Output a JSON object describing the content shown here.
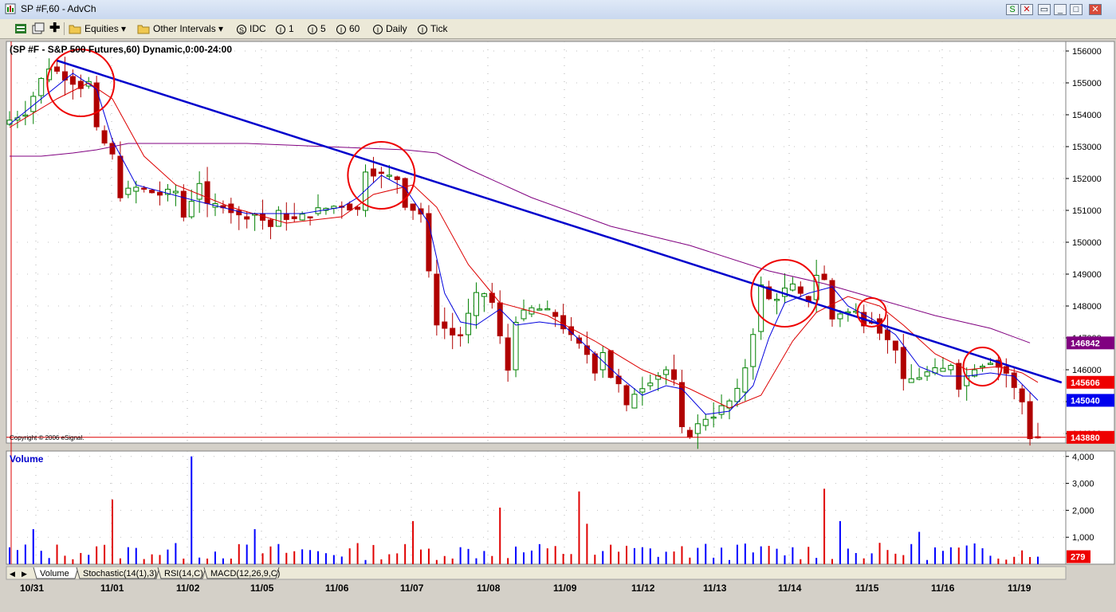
{
  "window": {
    "title": "SP #F,60 - AdvCh",
    "buttons": [
      "S",
      "✕",
      "▭",
      "_",
      "□",
      "✕"
    ]
  },
  "toolbar": {
    "symbol_group": "Equities",
    "interval_menu": "Other Intervals",
    "intervals": [
      {
        "prefix": "S",
        "label": "IDC"
      },
      {
        "prefix": "I",
        "label": "1"
      },
      {
        "prefix": "I",
        "label": "5"
      },
      {
        "prefix": "I",
        "label": "60"
      },
      {
        "prefix": "I",
        "label": "Daily"
      },
      {
        "prefix": "I",
        "label": "Tick"
      }
    ]
  },
  "colors": {
    "up": "#008000",
    "down": "#b00000",
    "ma_fast": "#0000dd",
    "ma_mid": "#dd0000",
    "ma_slow": "#800080",
    "trendline": "#0000cc",
    "circle": "#ee0000",
    "vol_up": "#0000ff",
    "vol_down": "#e00000",
    "bg": "#ffffff"
  },
  "chart_data": [
    {
      "type": "candlestick",
      "title": "(SP #F - S&P 500 Futures,60) Dynamic,0:00-24:00",
      "copyright": "Copyright © 2006 eSignal.",
      "x_labels": [
        "10/31",
        "11/01",
        "11/02",
        "11/05",
        "11/06",
        "11/07",
        "11/08",
        "11/09",
        "11/12",
        "11/13",
        "11/14",
        "11/15",
        "11/16",
        "11/19"
      ],
      "ylim": [
        143700,
        156300
      ],
      "y_ticks": [
        156000,
        155000,
        154000,
        153000,
        152000,
        151000,
        150000,
        149000,
        148000,
        147000,
        146000,
        145000,
        144000
      ],
      "y_tick_labels": [
        "156000",
        "155000",
        "154000",
        "153000",
        "152000",
        "151000",
        "150000",
        "149000",
        "148000",
        "147000",
        "146000",
        "145000",
        "144000"
      ],
      "price_tags": [
        {
          "label": "146842",
          "value": 146842,
          "color": "#800080"
        },
        {
          "label": "145606",
          "value": 145606,
          "color": "#ee0000"
        },
        {
          "label": "145040",
          "value": 145040,
          "color": "#0000ee"
        },
        {
          "label": "143880",
          "value": 143880,
          "color": "#ee0000"
        }
      ],
      "reference_line": 143880,
      "path": [
        [
          0,
          153700
        ],
        [
          3,
          154100
        ],
        [
          5,
          155100
        ],
        [
          6,
          155500
        ],
        [
          8,
          155200
        ],
        [
          10,
          154900
        ],
        [
          11,
          155000
        ],
        [
          12,
          153500
        ],
        [
          14,
          152700
        ],
        [
          15,
          151500
        ],
        [
          17,
          151700
        ],
        [
          20,
          151500
        ],
        [
          22,
          151600
        ],
        [
          23,
          150800
        ],
        [
          25,
          151900
        ],
        [
          26,
          151100
        ],
        [
          28,
          151200
        ],
        [
          30,
          150800
        ],
        [
          32,
          150900
        ],
        [
          34,
          150500
        ],
        [
          35,
          150900
        ],
        [
          37,
          150700
        ],
        [
          40,
          151000
        ],
        [
          43,
          151200
        ],
        [
          45,
          151000
        ],
        [
          46,
          152300
        ],
        [
          48,
          152100
        ],
        [
          50,
          152000
        ],
        [
          51,
          151200
        ],
        [
          53,
          150900
        ],
        [
          54,
          149000
        ],
        [
          55,
          147500
        ],
        [
          57,
          147100
        ],
        [
          58,
          147100
        ],
        [
          60,
          148300
        ],
        [
          61,
          148400
        ],
        [
          62,
          148100
        ],
        [
          63,
          147000
        ],
        [
          64,
          146000
        ],
        [
          65,
          147600
        ],
        [
          67,
          147900
        ],
        [
          68,
          147900
        ],
        [
          70,
          147700
        ],
        [
          72,
          147000
        ],
        [
          74,
          146500
        ],
        [
          75,
          146000
        ],
        [
          76,
          146600
        ],
        [
          77,
          145800
        ],
        [
          78,
          145500
        ],
        [
          79,
          144800
        ],
        [
          80,
          145300
        ],
        [
          81,
          145500
        ],
        [
          82,
          145700
        ],
        [
          84,
          146000
        ],
        [
          85,
          145600
        ],
        [
          86,
          144100
        ],
        [
          87,
          144000
        ],
        [
          89,
          144500
        ],
        [
          90,
          144600
        ],
        [
          92,
          145000
        ],
        [
          93,
          145300
        ],
        [
          94,
          146100
        ],
        [
          95,
          147200
        ],
        [
          96,
          148600
        ],
        [
          97,
          148200
        ],
        [
          98,
          148300
        ],
        [
          99,
          148500
        ],
        [
          100,
          148600
        ],
        [
          101,
          148300
        ],
        [
          102,
          148200
        ],
        [
          103,
          149000
        ],
        [
          104,
          148800
        ],
        [
          105,
          147600
        ],
        [
          106,
          147800
        ],
        [
          108,
          147800
        ],
        [
          109,
          147500
        ],
        [
          110,
          147600
        ],
        [
          112,
          146900
        ],
        [
          113,
          146700
        ],
        [
          114,
          145600
        ],
        [
          115,
          145700
        ],
        [
          117,
          145900
        ],
        [
          119,
          146000
        ],
        [
          120,
          146200
        ],
        [
          121,
          145500
        ],
        [
          123,
          146100
        ],
        [
          125,
          146300
        ],
        [
          126,
          146100
        ],
        [
          127,
          145900
        ],
        [
          128,
          145400
        ],
        [
          129,
          145000
        ],
        [
          130,
          143900
        ]
      ],
      "n_bars": 131,
      "ma_fast": [
        [
          0,
          153700
        ],
        [
          8,
          155300
        ],
        [
          11,
          154800
        ],
        [
          13,
          153200
        ],
        [
          16,
          151800
        ],
        [
          22,
          151400
        ],
        [
          30,
          150900
        ],
        [
          37,
          150900
        ],
        [
          42,
          151100
        ],
        [
          44,
          151400
        ],
        [
          47,
          152100
        ],
        [
          50,
          151700
        ],
        [
          53,
          150600
        ],
        [
          55,
          148400
        ],
        [
          57,
          147500
        ],
        [
          59,
          147400
        ],
        [
          62,
          147900
        ],
        [
          64,
          147400
        ],
        [
          67,
          147500
        ],
        [
          70,
          147400
        ],
        [
          74,
          146500
        ],
        [
          77,
          145800
        ],
        [
          80,
          145200
        ],
        [
          83,
          145500
        ],
        [
          85,
          145400
        ],
        [
          88,
          144600
        ],
        [
          91,
          144700
        ],
        [
          94,
          145500
        ],
        [
          96,
          147000
        ],
        [
          98,
          148100
        ],
        [
          101,
          148400
        ],
        [
          104,
          148600
        ],
        [
          106,
          148000
        ],
        [
          109,
          147600
        ],
        [
          112,
          147100
        ],
        [
          115,
          146100
        ],
        [
          118,
          145800
        ],
        [
          121,
          145800
        ],
        [
          124,
          145900
        ],
        [
          127,
          145800
        ],
        [
          130,
          145040
        ]
      ],
      "ma_mid": [
        [
          0,
          153600
        ],
        [
          6,
          154500
        ],
        [
          10,
          155000
        ],
        [
          13,
          154500
        ],
        [
          17,
          152700
        ],
        [
          21,
          151800
        ],
        [
          28,
          151100
        ],
        [
          35,
          150600
        ],
        [
          42,
          150800
        ],
        [
          46,
          151500
        ],
        [
          51,
          151800
        ],
        [
          54,
          151100
        ],
        [
          58,
          149300
        ],
        [
          62,
          148100
        ],
        [
          68,
          147700
        ],
        [
          74,
          146900
        ],
        [
          80,
          146000
        ],
        [
          86,
          145400
        ],
        [
          91,
          144800
        ],
        [
          95,
          145200
        ],
        [
          99,
          146900
        ],
        [
          102,
          147800
        ],
        [
          106,
          148300
        ],
        [
          110,
          148000
        ],
        [
          113,
          147400
        ],
        [
          117,
          146500
        ],
        [
          121,
          146000
        ],
        [
          125,
          146100
        ],
        [
          128,
          145900
        ],
        [
          130,
          145606
        ]
      ],
      "ma_slow": [
        [
          0,
          152700
        ],
        [
          4,
          152700
        ],
        [
          8,
          152800
        ],
        [
          11,
          152900
        ],
        [
          15,
          153100
        ],
        [
          22,
          153100
        ],
        [
          30,
          153100
        ],
        [
          40,
          153000
        ],
        [
          50,
          152900
        ],
        [
          54,
          152800
        ],
        [
          58,
          152300
        ],
        [
          66,
          151400
        ],
        [
          76,
          150500
        ],
        [
          86,
          149900
        ],
        [
          96,
          149100
        ],
        [
          103,
          148700
        ],
        [
          110,
          148200
        ],
        [
          117,
          147700
        ],
        [
          124,
          147300
        ],
        [
          129,
          146842
        ]
      ],
      "trendline": {
        "from": [
          6,
          155700
        ],
        "to": [
          133,
          145600
        ]
      },
      "circles": [
        {
          "x": 9,
          "y": 155000,
          "r": 42
        },
        {
          "x": 47,
          "y": 152100,
          "r": 42
        },
        {
          "x": 98,
          "y": 148400,
          "r": 42
        },
        {
          "x": 109,
          "y": 147800,
          "r": 18
        },
        {
          "x": 123,
          "y": 146100,
          "r": 24
        }
      ]
    },
    {
      "type": "bar",
      "title": "Volume",
      "ylim": [
        0,
        4200
      ],
      "y_ticks": [
        4000,
        3000,
        2000,
        1000
      ],
      "y_tick_labels": [
        "4,000",
        "3,000",
        "2,000",
        "1,000"
      ],
      "last_value_label": "279",
      "last_value": 279,
      "spikes": [
        {
          "bar": 3,
          "value": 1300
        },
        {
          "bar": 13,
          "value": 2400
        },
        {
          "bar": 23,
          "value": 4000
        },
        {
          "bar": 31,
          "value": 1300
        },
        {
          "bar": 51,
          "value": 1600
        },
        {
          "bar": 62,
          "value": 2100
        },
        {
          "bar": 72,
          "value": 2700
        },
        {
          "bar": 73,
          "value": 1500
        },
        {
          "bar": 103,
          "value": 2800
        },
        {
          "bar": 105,
          "value": 1600
        },
        {
          "bar": 115,
          "value": 1200
        }
      ]
    }
  ],
  "tabs": [
    "Volume",
    "Stochastic(14(1),3)",
    "RSI(14,C)",
    "MACD(12,26,9,C)"
  ]
}
